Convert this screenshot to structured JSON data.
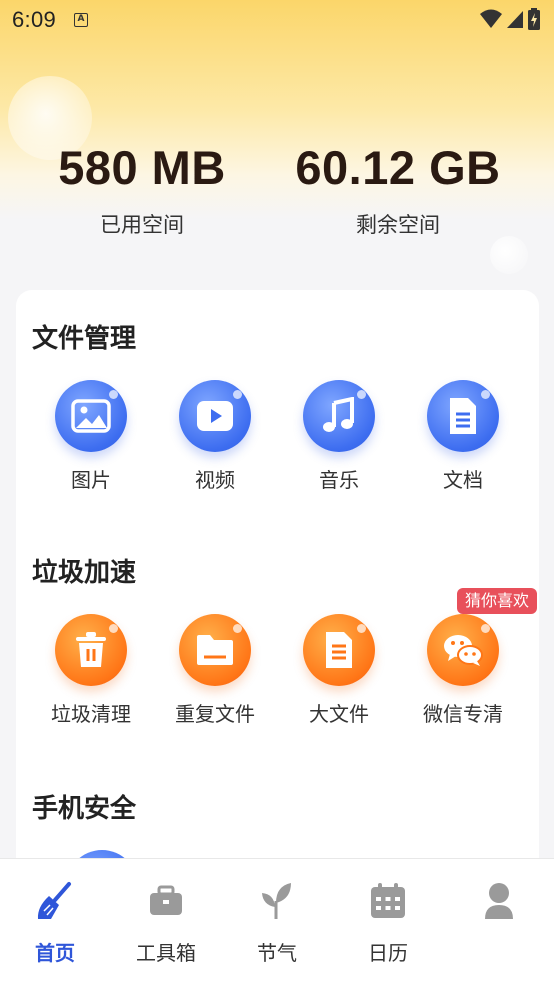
{
  "status_bar": {
    "time": "6:09",
    "notification_icon": "a-box-icon"
  },
  "storage": {
    "used": {
      "value": "580 MB",
      "label": "已用空间"
    },
    "free": {
      "value": "60.12 GB",
      "label": "剩余空间"
    }
  },
  "sections": {
    "file_management": {
      "title": "文件管理",
      "items": [
        {
          "label": "图片",
          "icon": "image-icon"
        },
        {
          "label": "视频",
          "icon": "video-icon"
        },
        {
          "label": "音乐",
          "icon": "music-icon"
        },
        {
          "label": "文档",
          "icon": "document-icon"
        }
      ]
    },
    "junk_speedup": {
      "title": "垃圾加速",
      "badge": "猜你喜欢",
      "items": [
        {
          "label": "垃圾清理",
          "icon": "trash-icon"
        },
        {
          "label": "重复文件",
          "icon": "folder-icon"
        },
        {
          "label": "大文件",
          "icon": "big-file-icon"
        },
        {
          "label": "微信专清",
          "icon": "wechat-icon"
        }
      ]
    },
    "phone_security": {
      "title": "手机安全"
    }
  },
  "tabbar": {
    "items": [
      {
        "label": "首页",
        "icon": "broom-icon",
        "active": true
      },
      {
        "label": "工具箱",
        "icon": "toolbox-icon",
        "active": false
      },
      {
        "label": "节气",
        "icon": "sprout-icon",
        "active": false
      },
      {
        "label": "日历",
        "icon": "calendar-icon",
        "active": false
      },
      {
        "label": "",
        "icon": "user-icon",
        "active": false
      }
    ]
  },
  "colors": {
    "accent_blue": "#2f56d9",
    "icon_blue": "#3d6df0",
    "icon_orange": "#ff7617",
    "badge_red": "#e8505b",
    "hero_yellow": "#fbd66a"
  }
}
